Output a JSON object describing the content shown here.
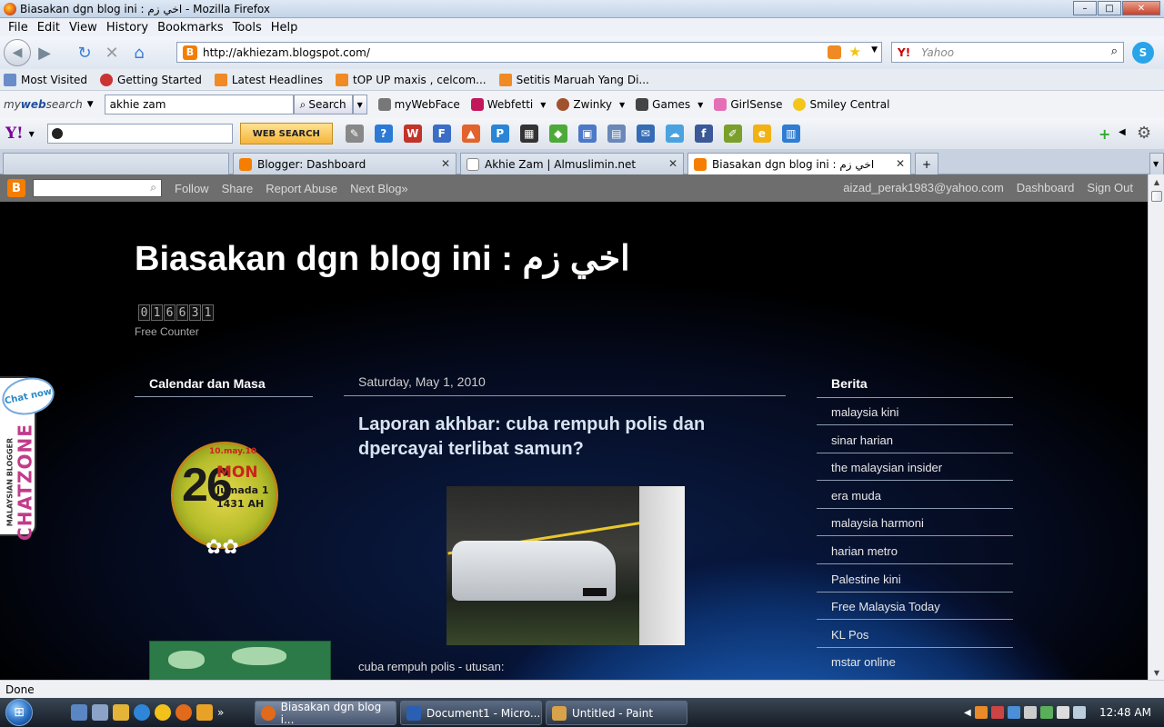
{
  "window": {
    "title": "Biasakan dgn blog ini : اخي زم - Mozilla Firefox",
    "min": "–",
    "max": "□",
    "close": "✕"
  },
  "menu": [
    "File",
    "Edit",
    "View",
    "History",
    "Bookmarks",
    "Tools",
    "Help"
  ],
  "nav": {
    "url": "http://akhiezam.blogspot.com/",
    "search_placeholder": "Yahoo",
    "search_engine_label": "Y!"
  },
  "bookmarks": [
    {
      "label": "Most Visited",
      "color": "#6a8cc8"
    },
    {
      "label": "Getting Started",
      "color": "#c33"
    },
    {
      "label": "Latest Headlines",
      "color": "#f08a24"
    },
    {
      "label": "tOP UP maxis , celcom...",
      "color": "#f08a24"
    },
    {
      "label": "Setitis Maruah Yang Di...",
      "color": "#f08a24"
    }
  ],
  "toolbar1": {
    "logo_prefix": "my",
    "logo_bold": "web",
    "logo_suffix": "search",
    "query": "akhie zam",
    "search_label": "Search",
    "items": [
      "myWebFace",
      "Webfetti",
      "Zwinky",
      "Games",
      "GirlSense",
      "Smiley Central"
    ]
  },
  "toolbar2": {
    "logo": "Y!",
    "web_search_label": "WEB SEARCH"
  },
  "tabs": [
    {
      "label": "",
      "active": false
    },
    {
      "label": "Blogger: Dashboard",
      "active": false
    },
    {
      "label": "Akhie Zam | Almuslimin.net",
      "active": false
    },
    {
      "label": "Biasakan dgn blog ini : اخي زم",
      "active": true
    }
  ],
  "bloggerbar": {
    "links_left": [
      "Follow",
      "Share",
      "Report Abuse",
      "Next Blog»"
    ],
    "links_right": [
      "aizad_perak1983@yahoo.com",
      "Dashboard",
      "Sign Out"
    ]
  },
  "blog": {
    "title": "Biasakan dgn blog ini : اخي زم",
    "counter_digits": [
      "0",
      "1",
      "6",
      "6",
      "3",
      "1"
    ],
    "counter_label": "Free Counter",
    "left_heading": "Calendar dan Masa",
    "calendar": {
      "date_small": "10.may.10",
      "day": "26",
      "weekday": "MON",
      "hijri": "Jumada 1 1431 AH"
    },
    "chat_bubble": "Chat now",
    "chat_vertical": "CHATZONE",
    "chat_vertical_small": "MALAYSIAN BLOGGER",
    "post_date": "Saturday, May 1, 2010",
    "post_title": "Laporan akhbar: cuba rempuh polis dan dpercayai terlibat samun?",
    "post_caption": "cuba rempuh polis - utusan:",
    "right_heading": "Berita",
    "news": [
      "malaysia kini",
      "sinar harian",
      "the malaysian insider",
      "era muda",
      "malaysia harmoni",
      "harian metro",
      "Palestine kini",
      "Free Malaysia Today",
      "KL Pos",
      "mstar online"
    ]
  },
  "status": {
    "text": "Done"
  },
  "taskbar": {
    "tasks": [
      "Biasakan dgn blog i...",
      "Document1 - Micro...",
      "Untitled - Paint"
    ],
    "more": "»",
    "clock": "12:48 AM"
  }
}
